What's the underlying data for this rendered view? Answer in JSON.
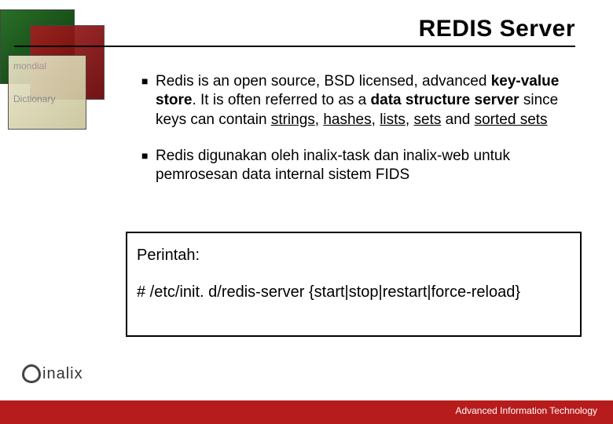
{
  "title": "REDIS Server",
  "decor": {
    "word1": "mondial",
    "word2": "Dictionary"
  },
  "bullets": [
    {
      "pre": "Redis is an open source, BSD licensed, advanced ",
      "b1": "key-value store",
      "mid1": ". It is often referred to as a ",
      "b2": "data structure server",
      "mid2": " since keys can contain ",
      "l1": "strings",
      "c1": ", ",
      "l2": "hashes",
      "c2": ", ",
      "l3": "lists",
      "c3": ", ",
      "l4": "sets",
      "c4": " and ",
      "l5": "sorted sets"
    },
    {
      "text": "Redis digunakan oleh inalix-task dan inalix-web untuk pemrosesan data internal sistem FIDS"
    }
  ],
  "command": {
    "label": "Perintah:",
    "line": "# /etc/init. d/redis-server {start|stop|restart|force-reload}"
  },
  "logo_text": "inalix",
  "footer": "Advanced Information Technology"
}
